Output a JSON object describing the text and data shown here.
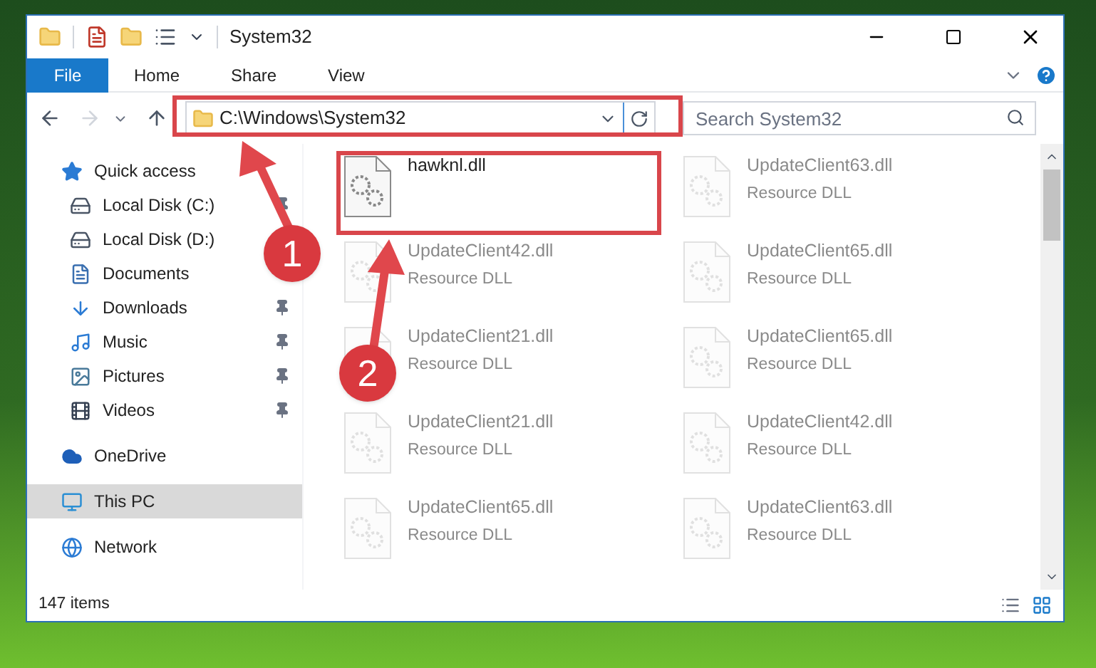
{
  "window": {
    "title": "System32"
  },
  "ribbon_tabs": [
    {
      "label": "File",
      "selected": true
    },
    {
      "label": "Home",
      "selected": false
    },
    {
      "label": "Share",
      "selected": false
    },
    {
      "label": "View",
      "selected": false
    }
  ],
  "address_bar": {
    "path": "C:\\Windows\\System32"
  },
  "search": {
    "placeholder": "Search System32"
  },
  "sidebar": {
    "items": [
      {
        "label": "Quick access",
        "kind": "star",
        "selected": false,
        "children": [
          {
            "label": "Local Disk (C:)",
            "kind": "drive-c",
            "pinned": true,
            "selected": false
          },
          {
            "label": "Local Disk (D:)",
            "kind": "drive",
            "pinned": false,
            "selected": false
          },
          {
            "label": "Documents",
            "kind": "documents",
            "pinned": false,
            "selected": false
          },
          {
            "label": "Downloads",
            "kind": "downloads",
            "pinned": true,
            "selected": false
          },
          {
            "label": "Music",
            "kind": "music",
            "pinned": true,
            "selected": false
          },
          {
            "label": "Pictures",
            "kind": "pictures",
            "pinned": true,
            "selected": false
          },
          {
            "label": "Videos",
            "kind": "videos",
            "pinned": true,
            "selected": false
          }
        ]
      },
      {
        "label": "OneDrive",
        "kind": "cloud",
        "selected": false
      },
      {
        "label": "This PC",
        "kind": "pc",
        "selected": true
      },
      {
        "label": "Network",
        "kind": "network",
        "selected": false
      }
    ]
  },
  "files": [
    {
      "name": "hawknl.dll",
      "blurred": false
    },
    {
      "name": "UpdateClient63.dll",
      "type": "Resource DLL",
      "blurred": true
    },
    {
      "name": "UpdateClient42.dll",
      "type": "Resource DLL",
      "blurred": true
    },
    {
      "name": "UpdateClient65.dll",
      "type": "Resource DLL",
      "blurred": true
    },
    {
      "name": "UpdateClient21.dll",
      "type": "Resource DLL",
      "blurred": true
    },
    {
      "name": "UpdateClient65.dll",
      "type": "Resource DLL",
      "blurred": true
    },
    {
      "name": "UpdateClient21.dll",
      "type": "Resource DLL",
      "blurred": true
    },
    {
      "name": "UpdateClient42.dll",
      "type": "Resource DLL",
      "blurred": true
    },
    {
      "name": "UpdateClient65.dll",
      "type": "Resource DLL",
      "blurred": true
    },
    {
      "name": "UpdateClient63.dll",
      "type": "Resource DLL",
      "blurred": true
    }
  ],
  "annotations": [
    {
      "label": "1"
    },
    {
      "label": "2"
    }
  ],
  "status_bar": {
    "item_count": "147 items"
  }
}
